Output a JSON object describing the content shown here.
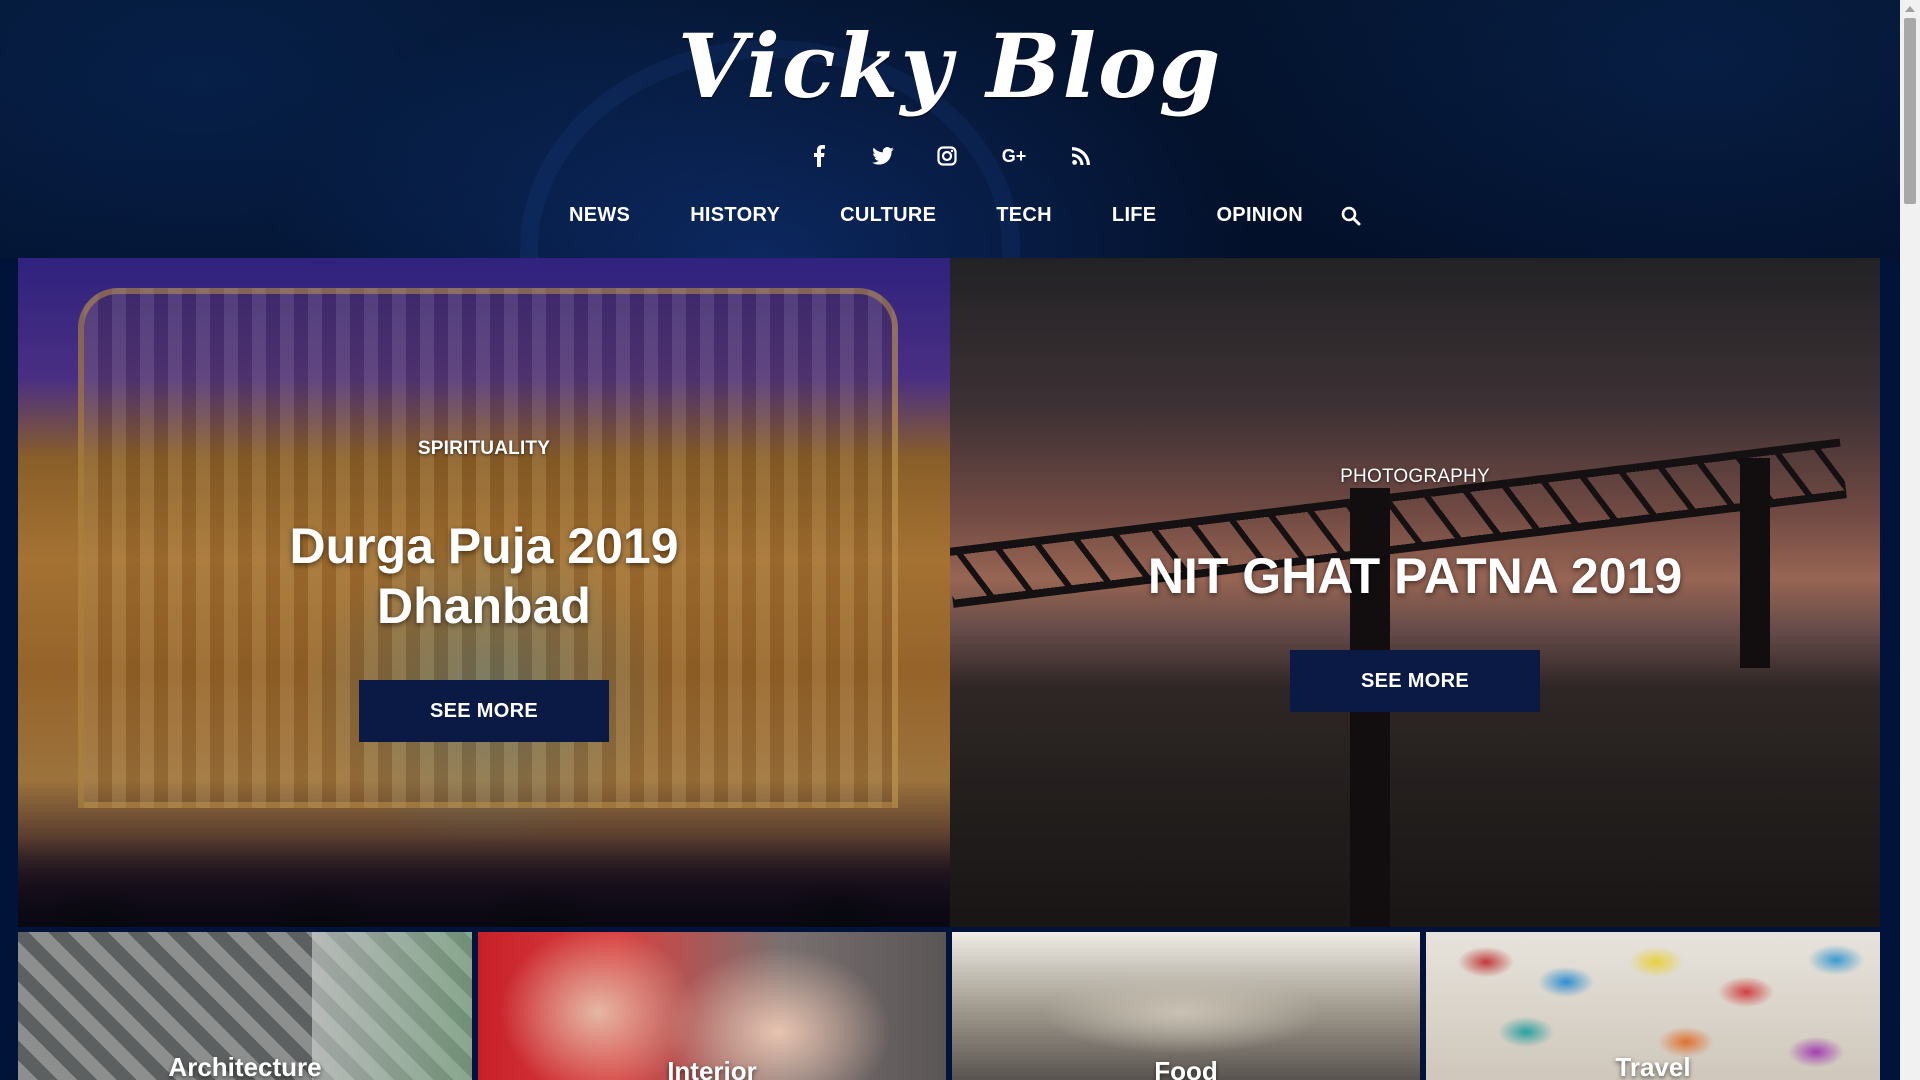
{
  "site": {
    "logo": "Vicky Blog"
  },
  "social": [
    {
      "icon": "facebook-icon",
      "glyph": "f"
    },
    {
      "icon": "twitter-icon",
      "glyph": ""
    },
    {
      "icon": "instagram-icon",
      "glyph": ""
    },
    {
      "icon": "google-plus-icon",
      "glyph": "G+"
    },
    {
      "icon": "rss-icon",
      "glyph": ""
    }
  ],
  "nav": {
    "items": [
      "NEWS",
      "HISTORY",
      "CULTURE",
      "TECH",
      "LIFE",
      "OPINION"
    ],
    "search_icon": "search-icon"
  },
  "featured": [
    {
      "category": "SPIRITUALITY",
      "title_line1": "Durga Puja 2019",
      "title_line2": "Dhanbad",
      "button": "SEE MORE"
    },
    {
      "category": "PHOTOGRAPHY",
      "title_line1": "NIT GHAT PATNA 2019",
      "button": "SEE MORE"
    }
  ],
  "categories": [
    "Architecture",
    "Interior",
    "Food",
    "Travel"
  ],
  "colors": {
    "header_bg": "#03102a",
    "button_bg": "#0b1a44",
    "page_bg": "#02133a"
  }
}
